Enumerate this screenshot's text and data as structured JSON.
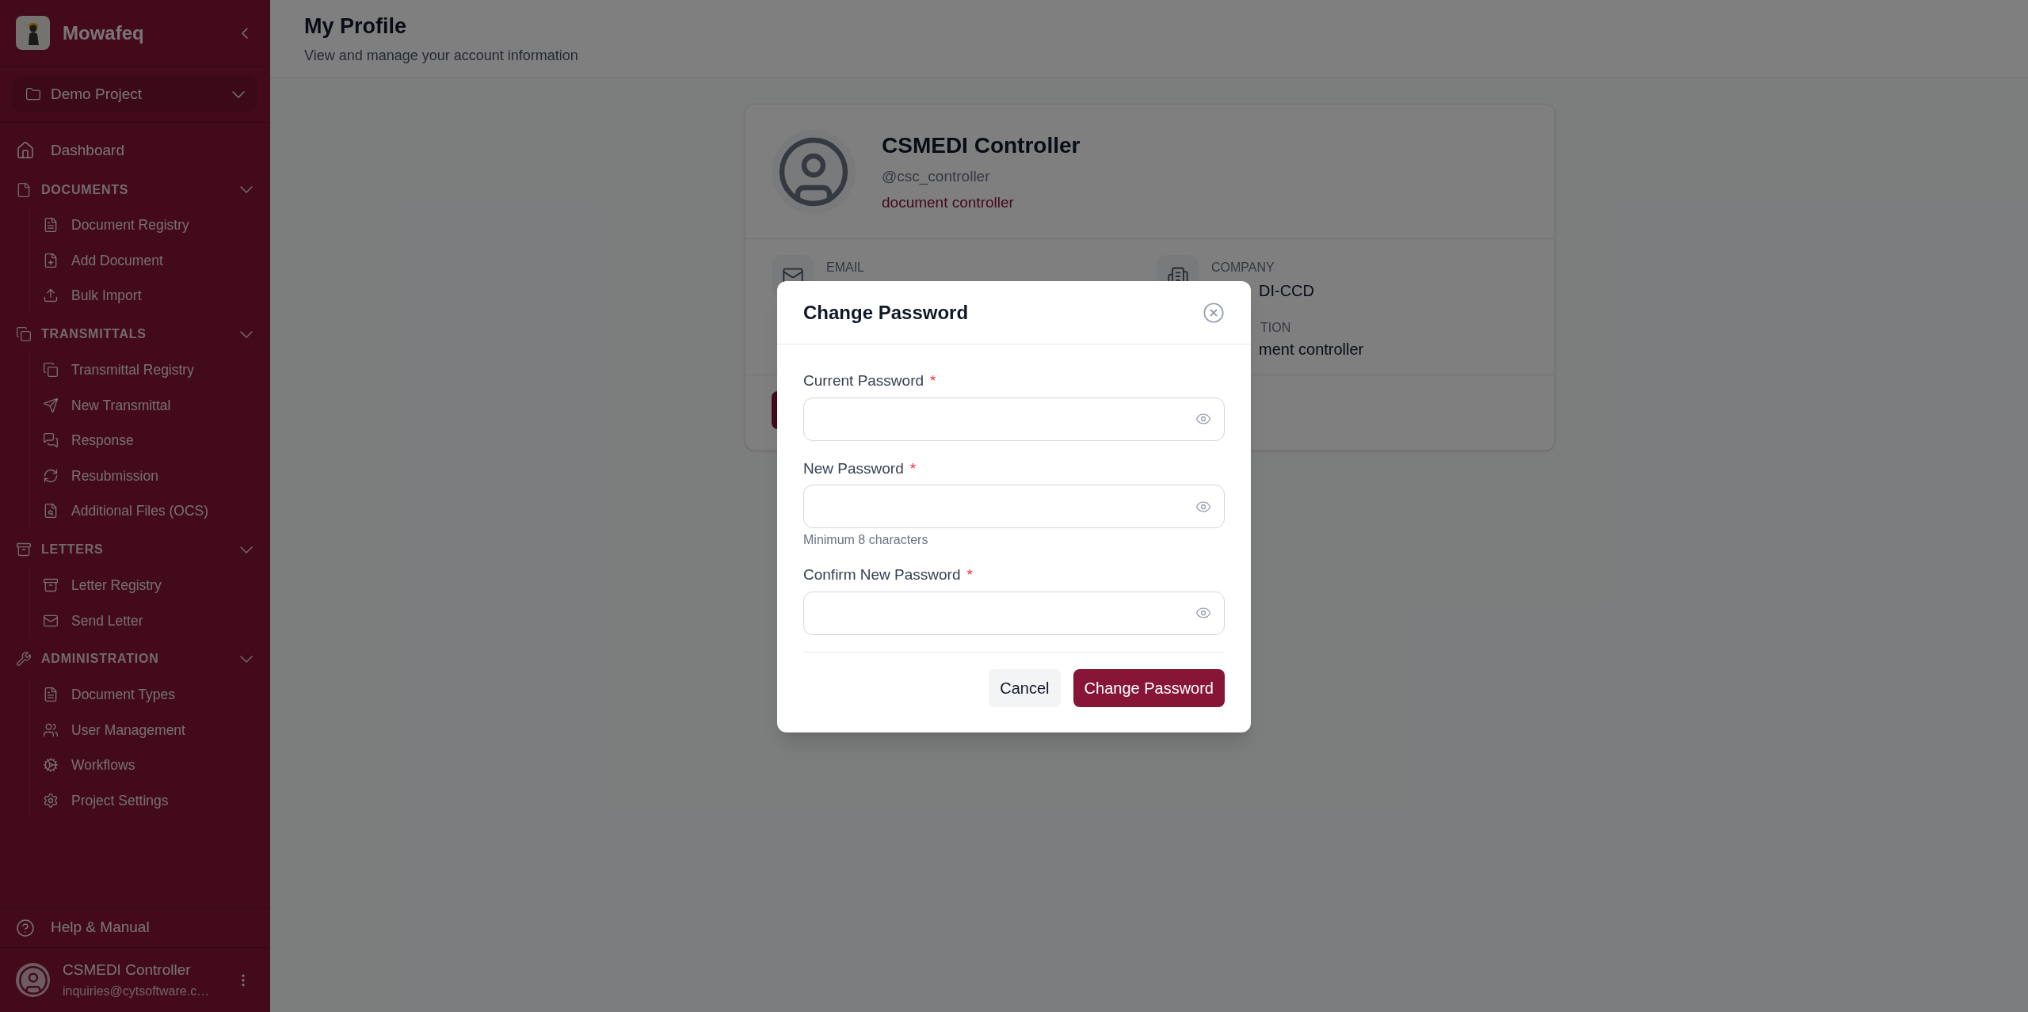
{
  "sidebar": {
    "app_name": "Mowafeq",
    "project": "Demo Project",
    "top_items": [
      {
        "label": "Dashboard"
      }
    ],
    "sections": [
      {
        "title": "DOCUMENTS",
        "expanded": true,
        "items": [
          {
            "label": "Document Registry"
          },
          {
            "label": "Add Document"
          },
          {
            "label": "Bulk Import"
          }
        ]
      },
      {
        "title": "TRANSMITTALS",
        "expanded": true,
        "items": [
          {
            "label": "Transmittal Registry"
          },
          {
            "label": "New Transmittal"
          },
          {
            "label": "Response"
          },
          {
            "label": "Resubmission"
          },
          {
            "label": "Additional Files (OCS)"
          }
        ]
      },
      {
        "title": "LETTERS",
        "expanded": true,
        "items": [
          {
            "label": "Letter Registry"
          },
          {
            "label": "Send Letter"
          }
        ]
      },
      {
        "title": "ADMINISTRATION",
        "expanded": true,
        "items": [
          {
            "label": "Document Types"
          },
          {
            "label": "User Management"
          },
          {
            "label": "Workflows"
          },
          {
            "label": "Project Settings"
          }
        ]
      }
    ],
    "help": "Help & Manual",
    "user": {
      "name": "CSMEDI Controller",
      "email": "inquiries@cytsoftware.c…"
    }
  },
  "header": {
    "title": "My Profile",
    "subtitle": "View and manage your account information"
  },
  "profile": {
    "name": "CSMEDI Controller",
    "username": "@csc_controller",
    "role": "document controller",
    "fields": [
      {
        "label": "EMAIL"
      },
      {
        "label": "COMPANY",
        "value": "DI-CCD"
      },
      {
        "label": "TION",
        "value": "ment controller"
      }
    ]
  },
  "modal": {
    "title": "Change Password",
    "fields": [
      {
        "label": "Current Password",
        "required_mark": "*"
      },
      {
        "label": "New Password",
        "required_mark": "*",
        "hint": "Minimum 8 characters"
      },
      {
        "label": "Confirm New Password",
        "required_mark": "*"
      }
    ],
    "buttons": [
      {
        "label": "Cancel",
        "kind": "secondary"
      },
      {
        "label": "Change Password",
        "kind": "primary"
      }
    ]
  }
}
